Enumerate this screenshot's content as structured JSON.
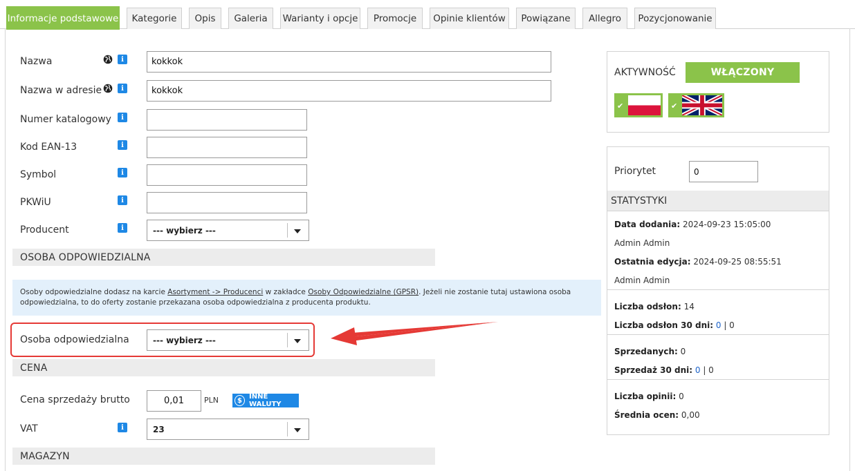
{
  "tabs": [
    {
      "label": "Informacje podstawowe"
    },
    {
      "label": "Kategorie"
    },
    {
      "label": "Opis"
    },
    {
      "label": "Galeria"
    },
    {
      "label": "Warianty i opcje"
    },
    {
      "label": "Promocje"
    },
    {
      "label": "Opinie klientów"
    },
    {
      "label": "Powiązane"
    },
    {
      "label": "Allegro"
    },
    {
      "label": "Pozycjonowanie"
    }
  ],
  "form": {
    "name_label": "Nazwa",
    "name_value": "kokkok",
    "url_label": "Nazwa w adresie",
    "url_value": "kokkok",
    "catalog_label": "Numer katalogowy",
    "catalog_value": "",
    "ean_label": "Kod EAN-13",
    "ean_value": "",
    "symbol_label": "Symbol",
    "symbol_value": "",
    "pkwiu_label": "PKWiU",
    "pkwiu_value": "",
    "producer_label": "Producent",
    "producer_value": "--- wybierz ---",
    "info_glyph": "i"
  },
  "responsible": {
    "section_title": "OSOBA ODPOWIEDZIALNA",
    "notice_1": "Osoby odpowiedzialne dodasz na karcie ",
    "notice_link1": "Asortyment -> Producenci",
    "notice_2": " w zakładce ",
    "notice_link2": "Osoby Odpowiedzialne (GPSR)",
    "notice_3": ". Jeżeli nie zostanie tutaj ustawiona osoba odpowiedzialna, to do oferty zostanie przekazana osoba odpowiedzialna z producenta produktu.",
    "person_label": "Osoba odpowiedzialna",
    "person_value": "--- wybierz ---"
  },
  "price": {
    "section_title": "CENA",
    "gross_label": "Cena sprzedaży brutto",
    "gross_value": "0,01",
    "currency": "PLN",
    "other_currencies": "INNE WALUTY",
    "coin_glyph": "$",
    "vat_label": "VAT",
    "vat_value": "23"
  },
  "stock": {
    "section_title": "MAGAZYN"
  },
  "sidebar": {
    "activity_label": "AKTYWNOŚĆ",
    "activity_value": "WŁĄCZONY",
    "check_glyph": "✔",
    "priority_label": "Priorytet",
    "priority_value": "0",
    "stats_title": "STATYSTYKI",
    "date_added_label": "Data dodania:",
    "date_added_value": " 2024-09-23 15:05:00",
    "added_by": "Admin Admin",
    "last_edit_label": "Ostatnia edycja:",
    "last_edit_value": " 2024-09-25 08:55:51",
    "edited_by": "Admin Admin",
    "views_label": "Liczba odsłon:",
    "views_value": " 14",
    "views30_label": "Liczba odsłon 30 dni:",
    "views30_link": " 0",
    "views30_rest": " | 0",
    "sold_label": "Sprzedanych:",
    "sold_value": " 0",
    "sales30_label": "Sprzedaż 30 dni:",
    "sales30_link": " 0",
    "sales30_rest": " | 0",
    "reviews_label": "Liczba opinii:",
    "reviews_value": " 0",
    "avg_label": "Średnia ocen:",
    "avg_value": " 0,00"
  },
  "colors": {
    "accent_green": "#8bc34a",
    "info_blue": "#1e88e5",
    "highlight_red": "#e53935"
  }
}
